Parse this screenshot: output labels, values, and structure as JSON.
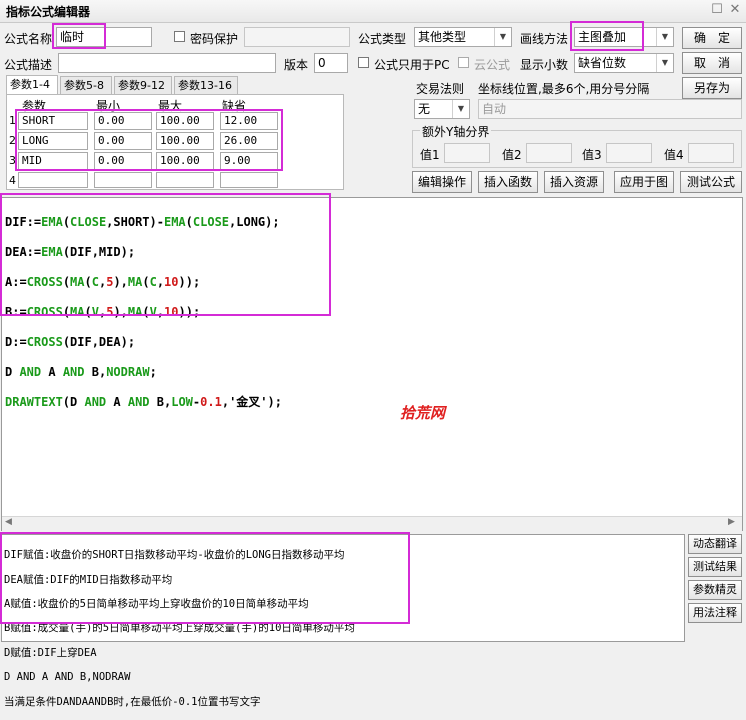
{
  "window": {
    "title": "指标公式编辑器",
    "restore": "☐",
    "close": "✕"
  },
  "top": {
    "name_label": "公式名称",
    "name_value": "临时",
    "pwd_label": "密码保护",
    "type_label": "公式类型",
    "type_value": "其他类型",
    "draw_label": "画线方法",
    "draw_value": "主图叠加",
    "ok": "确　定",
    "cancel": "取　消",
    "saveas": "另存为",
    "desc_label": "公式描述",
    "version_label": "版本",
    "version_value": "0",
    "pc_only_label": "公式只用于PC",
    "cloud_label": "云公式",
    "decimals_label": "显示小数",
    "decimals_value": "缺省位数"
  },
  "tabs": [
    "参数1-4",
    "参数5-8",
    "参数9-12",
    "参数13-16"
  ],
  "params": {
    "headers": [
      "参数",
      "最小",
      "最大",
      "缺省"
    ],
    "rows": [
      {
        "idx": "1",
        "name": "SHORT",
        "min": "0.00",
        "max": "100.00",
        "def": "12.00"
      },
      {
        "idx": "2",
        "name": "LONG",
        "min": "0.00",
        "max": "100.00",
        "def": "26.00"
      },
      {
        "idx": "3",
        "name": "MID",
        "min": "0.00",
        "max": "100.00",
        "def": "9.00"
      },
      {
        "idx": "4",
        "name": "",
        "min": "",
        "max": "",
        "def": ""
      }
    ]
  },
  "trade": {
    "label": "交易法则",
    "value": "无",
    "coord_label": "坐标线位置,最多6个,用分号分隔",
    "coord_value": "自动"
  },
  "yaxis": {
    "title": "额外Y轴分界",
    "v1": "值1",
    "v2": "值2",
    "v3": "值3",
    "v4": "值4"
  },
  "actions": [
    "编辑操作",
    "插入函数",
    "插入资源",
    "应用于图",
    "测试公式"
  ],
  "code_lines": [
    "DIF:=EMA(CLOSE,SHORT)-EMA(CLOSE,LONG);",
    "DEA:=EMA(DIF,MID);",
    "A:=CROSS(MA(C,5),MA(C,10));",
    "B:=CROSS(MA(V,5),MA(V,10));",
    "D:=CROSS(DIF,DEA);",
    "D AND A AND B,NODRAW;",
    "DRAWTEXT(D AND A AND B,LOW-0.1,'金叉');"
  ],
  "watermark": "拾荒网",
  "explain_lines": [
    "DIF赋值:收盘价的SHORT日指数移动平均-收盘价的LONG日指数移动平均",
    "DEA赋值:DIF的MID日指数移动平均",
    "A赋值:收盘价的5日简单移动平均上穿收盘价的10日简单移动平均",
    "B赋值:成交量(手)的5日简单移动平均上穿成交量(手)的10日简单移动平均",
    "D赋值:DIF上穿DEA",
    "D AND A AND B,NODRAW",
    "当满足条件DANDAANDB时,在最低价-0.1位置书写文字"
  ],
  "side_buttons": [
    "动态翻译",
    "测试结果",
    "参数精灵",
    "用法注释"
  ],
  "colors": {
    "highlight": "#d42bd6",
    "function": "#1a9a1a",
    "number": "#d01a1a",
    "watermark": "#e02020"
  }
}
